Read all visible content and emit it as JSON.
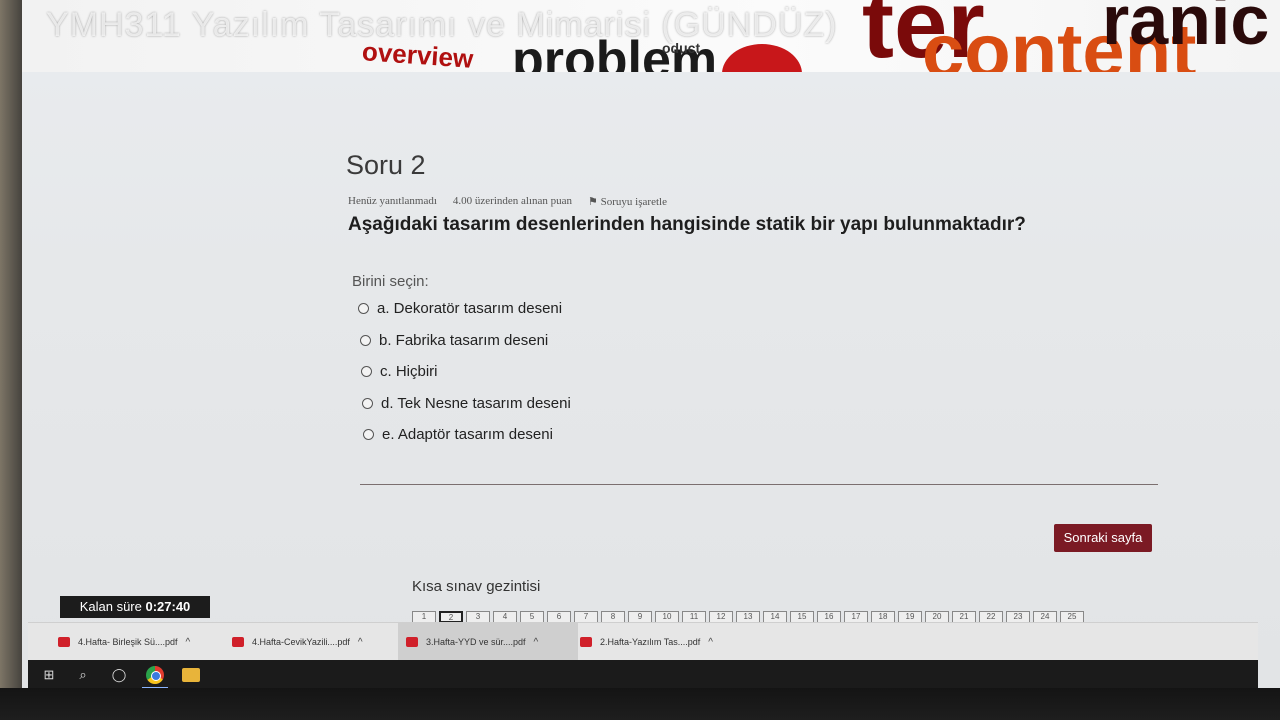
{
  "header": {
    "course_title": "YMH311 Yazılım Tasarımı ve Mimarisi (GÜNDÜZ)",
    "banner_words": [
      "overview",
      "problem",
      "ter",
      "content",
      "ranic",
      "oduct"
    ]
  },
  "question": {
    "heading": "Soru 2",
    "status": "Henüz yanıtlanmadı",
    "points": "4.00 üzerinden alınan puan",
    "flag_label": "Soruyu işaretle",
    "text": "Aşağıdaki tasarım desenlerinden hangisinde statik bir yapı bulunmaktadır?",
    "choose_label": "Birini seçin:",
    "options": [
      "a. Dekoratör tasarım deseni",
      "b. Fabrika tasarım deseni",
      "c. Hiçbiri",
      "d. Tek Nesne tasarım deseni",
      "e. Adaptör tasarım deseni"
    ]
  },
  "next_button": "Sonraki sayfa",
  "quiz_nav": {
    "title": "Kısa sınav gezintisi",
    "pages": [
      "1",
      "2",
      "3",
      "4",
      "5",
      "6",
      "7",
      "8",
      "9",
      "10",
      "11",
      "12",
      "13",
      "14",
      "15",
      "16",
      "17",
      "18",
      "19",
      "20",
      "21",
      "22",
      "23",
      "24",
      "25"
    ],
    "current": "2"
  },
  "timer": {
    "label": "Kalan süre",
    "value": "0:27:40"
  },
  "downloads": [
    "4.Hafta- Birleşik Sü....pdf",
    "4.Hafta-CevikYazili....pdf",
    "3.Hafta-YYD ve sür....pdf",
    "2.Hafta-Yazılım Tas....pdf"
  ],
  "colors": {
    "accent_button": "#7b1a24",
    "pdf_red": "#d0202a"
  }
}
